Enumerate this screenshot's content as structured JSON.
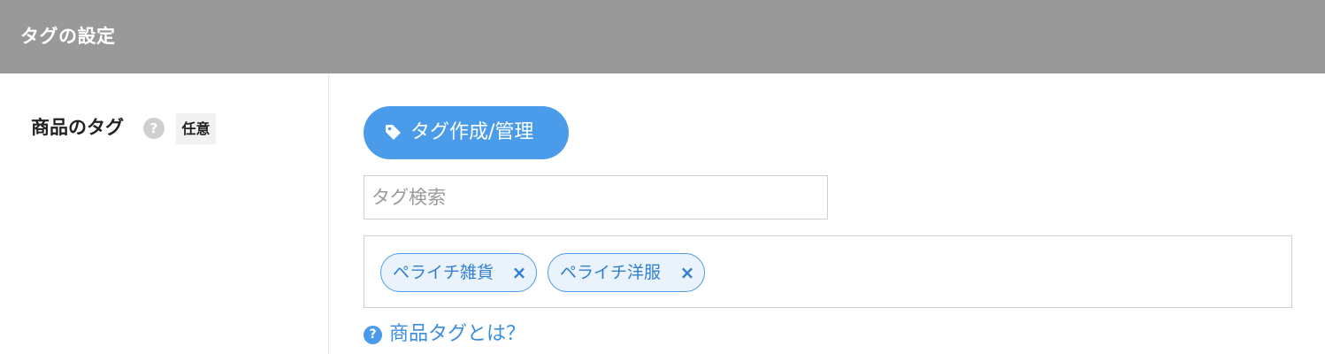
{
  "section": {
    "title": "タグの設定"
  },
  "field": {
    "label": "商品のタグ",
    "help_icon": "question-icon",
    "help_glyph": "?",
    "optional_badge": "任意"
  },
  "tag_manage_button": {
    "label": "タグ作成/管理",
    "icon": "tag-icon"
  },
  "tag_search": {
    "value": "",
    "placeholder": "タグ検索"
  },
  "selected_tags": [
    {
      "label": "ペライチ雑貨",
      "remove_glyph": "×"
    },
    {
      "label": "ペライチ洋服",
      "remove_glyph": "×"
    }
  ],
  "help_link": {
    "label": "商品タグとは？",
    "icon": "question-icon",
    "icon_glyph": "?"
  },
  "colors": {
    "header_bg": "#999999",
    "accent": "#4a9be9",
    "chip_bg": "#eaf3fc",
    "link": "#3a8ee0"
  }
}
